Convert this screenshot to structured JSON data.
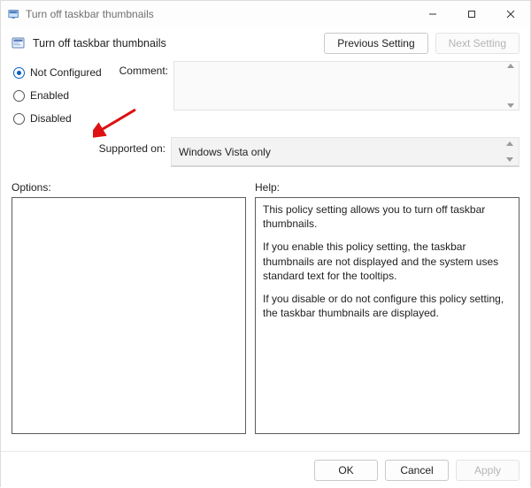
{
  "window": {
    "title": "Turn off taskbar thumbnails"
  },
  "header": {
    "policy_title": "Turn off taskbar thumbnails",
    "prev_btn": "Previous Setting",
    "next_btn": "Next Setting"
  },
  "radios": {
    "not_configured": "Not Configured",
    "enabled": "Enabled",
    "disabled": "Disabled",
    "selected": "not_configured"
  },
  "labels": {
    "comment": "Comment:",
    "supported_on": "Supported on:",
    "options": "Options:",
    "help": "Help:"
  },
  "fields": {
    "comment_value": "",
    "supported_value": "Windows Vista only"
  },
  "help": {
    "p1": "This policy setting allows you to turn off taskbar thumbnails.",
    "p2": "If you enable this policy setting, the taskbar thumbnails are not displayed and the system uses standard text for the tooltips.",
    "p3": "If you disable or do not configure this policy setting, the taskbar thumbnails are displayed."
  },
  "footer": {
    "ok": "OK",
    "cancel": "Cancel",
    "apply": "Apply"
  }
}
